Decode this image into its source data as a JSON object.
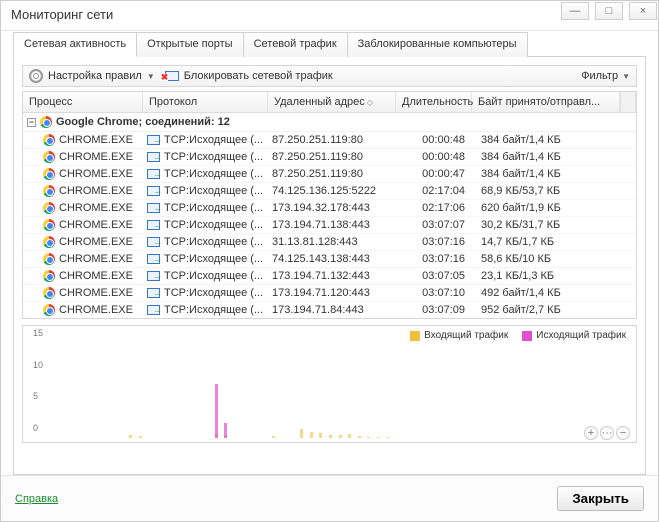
{
  "window": {
    "title": "Мониторинг сети"
  },
  "winctrl": {
    "min": "—",
    "max": "□",
    "close": "×"
  },
  "tabs": [
    {
      "label": "Сетевая активность",
      "active": true
    },
    {
      "label": "Открытые порты",
      "active": false
    },
    {
      "label": "Сетевой трафик",
      "active": false
    },
    {
      "label": "Заблокированные компьютеры",
      "active": false
    }
  ],
  "toolbar": {
    "rules_label": "Настройка правил",
    "block_label": "Блокировать сетевой трафик",
    "filter_label": "Фильтр"
  },
  "columns": {
    "process": "Процесс",
    "protocol": "Протокол",
    "remote": "Удаленный адрес",
    "duration": "Длительность",
    "bytes": "Байт принято/отправл..."
  },
  "group": {
    "expand": "−",
    "label": "Google Chrome; соединений: 12"
  },
  "rows": [
    {
      "process": "CHROME.EXE",
      "protocol": "TCP:Исходящее (...",
      "remote": "87.250.251.119:80",
      "dur": "00:00:48",
      "bytes": "384 байт/1,4 КБ"
    },
    {
      "process": "CHROME.EXE",
      "protocol": "TCP:Исходящее (...",
      "remote": "87.250.251.119:80",
      "dur": "00:00:48",
      "bytes": "384 байт/1,4 КБ"
    },
    {
      "process": "CHROME.EXE",
      "protocol": "TCP:Исходящее (...",
      "remote": "87.250.251.119:80",
      "dur": "00:00:47",
      "bytes": "384 байт/1,4 КБ"
    },
    {
      "process": "CHROME.EXE",
      "protocol": "TCP:Исходящее (...",
      "remote": "74.125.136.125:5222",
      "dur": "02:17:04",
      "bytes": "68,9 КБ/53,7 КБ"
    },
    {
      "process": "CHROME.EXE",
      "protocol": "TCP:Исходящее (...",
      "remote": "173.194.32.178:443",
      "dur": "02:17:06",
      "bytes": "620 байт/1,9 КБ"
    },
    {
      "process": "CHROME.EXE",
      "protocol": "TCP:Исходящее (...",
      "remote": "173.194.71.138:443",
      "dur": "03:07:07",
      "bytes": "30,2 КБ/31,7 КБ"
    },
    {
      "process": "CHROME.EXE",
      "protocol": "TCP:Исходящее (...",
      "remote": "31.13.81.128:443",
      "dur": "03:07:16",
      "bytes": "14,7 КБ/1,7 КБ"
    },
    {
      "process": "CHROME.EXE",
      "protocol": "TCP:Исходящее (...",
      "remote": "74.125.143.138:443",
      "dur": "03:07:16",
      "bytes": "58,6 КБ/10 КБ"
    },
    {
      "process": "CHROME.EXE",
      "protocol": "TCP:Исходящее (...",
      "remote": "173.194.71.132:443",
      "dur": "03:07:05",
      "bytes": "23,1 КБ/1,3 КБ"
    },
    {
      "process": "CHROME.EXE",
      "protocol": "TCP:Исходящее (...",
      "remote": "173.194.71.120:443",
      "dur": "03:07:10",
      "bytes": "492 байт/1,4 КБ"
    },
    {
      "process": "CHROME.EXE",
      "protocol": "TCP:Исходящее (...",
      "remote": "173.194.71.84:443",
      "dur": "03:07:09",
      "bytes": "952 байт/2,7 КБ"
    }
  ],
  "chart_data": {
    "type": "bar",
    "title": "",
    "xlabel": "",
    "ylabel": "",
    "ylim": [
      0,
      15
    ],
    "yticks": [
      0,
      5,
      10,
      15
    ],
    "series": [
      {
        "name": "Входящий трафик",
        "color": "#f0c040",
        "values": [
          0,
          0,
          0,
          0,
          0,
          0,
          0,
          0,
          0.4,
          0.3,
          0,
          0,
          0,
          0,
          0,
          0,
          0,
          0.6,
          0.4,
          0,
          0,
          0,
          0,
          0.3,
          0,
          0,
          1.4,
          1.0,
          0.8,
          0.5,
          0.4,
          0.6,
          0.3,
          0.2,
          0.2,
          0.2,
          0,
          0,
          0,
          0,
          0,
          0,
          0,
          0,
          0,
          0,
          0,
          0,
          0,
          0,
          0,
          0,
          0,
          0,
          0,
          0,
          0,
          0,
          0,
          0
        ]
      },
      {
        "name": "Исходящий трафик",
        "color": "#e04fd0",
        "values": [
          0,
          0,
          0,
          0,
          0,
          0,
          0,
          0,
          0,
          0,
          0,
          0,
          0,
          0,
          0,
          0,
          0,
          8.5,
          2.4,
          0,
          0,
          0,
          0,
          0,
          0,
          0,
          0,
          0,
          0,
          0,
          0,
          0,
          0,
          0,
          0,
          0,
          0,
          0,
          0,
          0,
          0,
          0,
          0,
          0,
          0,
          0,
          0,
          0,
          0,
          0,
          0,
          0,
          0,
          0,
          0,
          0,
          0,
          0,
          0,
          0
        ]
      }
    ]
  },
  "legend": {
    "incoming": "Входящий трафик",
    "outgoing": "Исходящий трафик"
  },
  "footer": {
    "help": "Справка",
    "close": "Закрыть"
  },
  "zoom": {
    "in": "+",
    "sep": "···",
    "out": "−"
  }
}
